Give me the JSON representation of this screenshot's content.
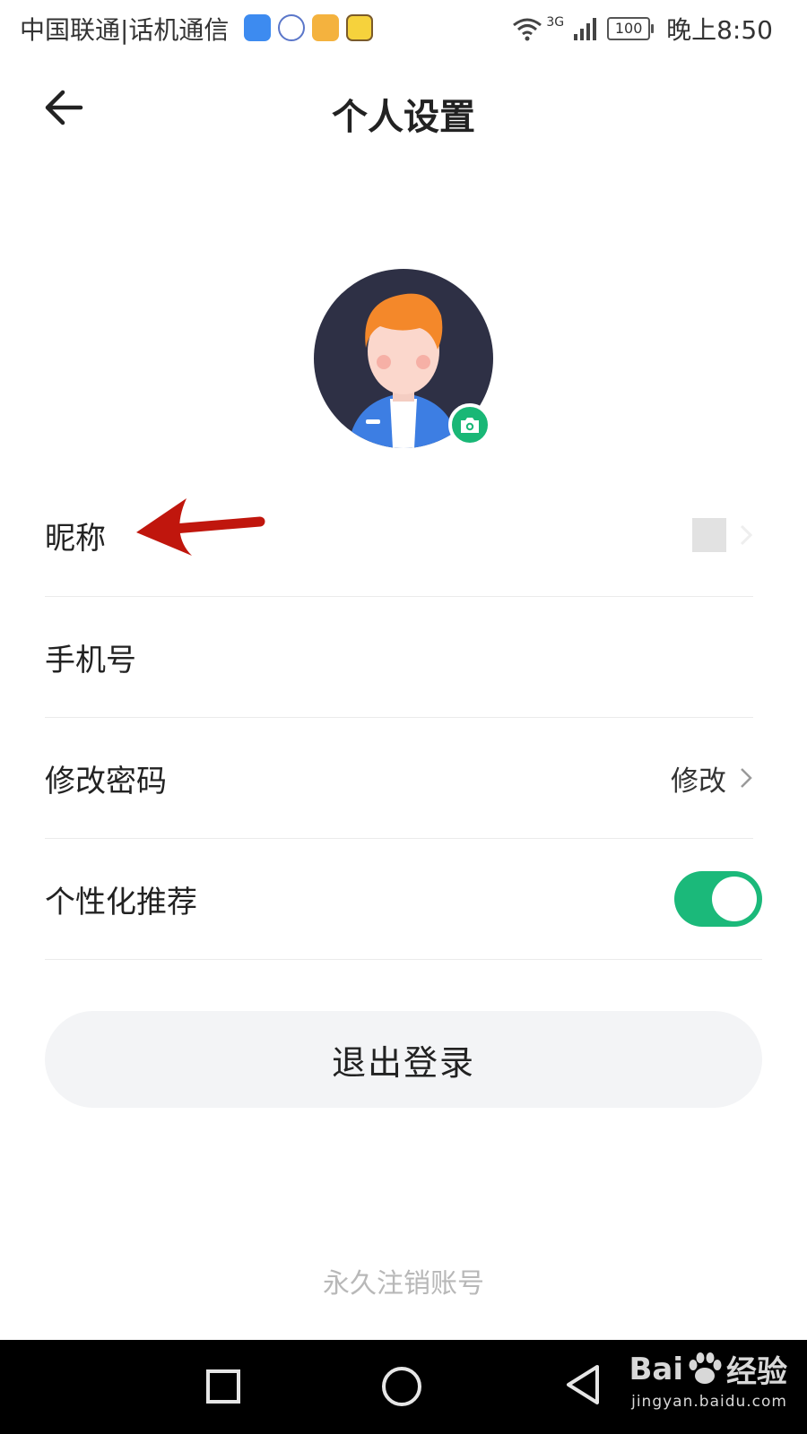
{
  "status_bar": {
    "carrier": "中国联通|话机通信",
    "network": "3G",
    "battery": "100",
    "time": "晚上8:50"
  },
  "header": {
    "title": "个人设置"
  },
  "settings": {
    "nickname_label": "昵称",
    "phone_label": "手机号",
    "password_label": "修改密码",
    "password_action": "修改",
    "personalized_label": "个性化推荐",
    "personalized_enabled": true
  },
  "logout_label": "退出登录",
  "delete_account_label": "永久注销账号",
  "watermark": {
    "brand": "Bai",
    "brand_suffix": "经验",
    "url": "jingyan.baidu.com"
  },
  "colors": {
    "accent_green": "#1bb97a",
    "annotation_red": "#c0160d"
  },
  "icons": {
    "back": "arrow-left-icon",
    "camera": "camera-icon",
    "chevron": "chevron-right-icon"
  }
}
